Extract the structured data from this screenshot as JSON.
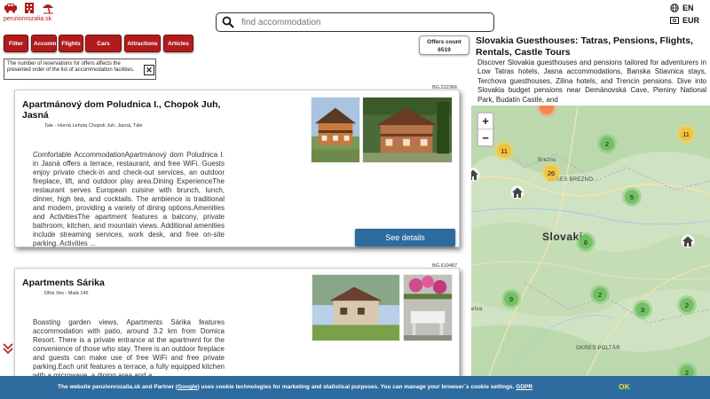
{
  "site": {
    "logo_text": "penzionrozalia.sk"
  },
  "search": {
    "placeholder": "find accommodation"
  },
  "lang": {
    "language": "EN",
    "currency": "EUR"
  },
  "nav": [
    {
      "label": "Filter"
    },
    {
      "label": "Accommodation"
    },
    {
      "label": "Flights"
    },
    {
      "label": "Cars"
    },
    {
      "label": "Attractions"
    },
    {
      "label": "Articles"
    }
  ],
  "offers": {
    "label": "Offers count",
    "count": "6519"
  },
  "notice": {
    "text": "The number of reservations for offers affects the presented order of the list of accommodation facilities."
  },
  "listings": [
    {
      "code": "BG.222366",
      "title": "Apartmánový dom Poludnica I., Chopok Juh, Jasná",
      "address": "Tale - Horná Lehota Chopok Juh, Jasná, Tále",
      "description": "Comfortable AccommodationApartmánový dom Poludnica I. in Jasná offers a terrace, restaurant, and free WiFi. Guests enjoy private check-in and check-out services, an outdoor fireplace, lift, and outdoor play area.Dining ExperienceThe restaurant serves European cuisine with brunch, lunch, dinner, high tea, and cocktails. The ambience is traditional and modern, providing a variety of dining options.Amenities and ActivitiesThe apartment features a balcony, private bathroom, kitchen, and mountain views. Additional amenities include streaming services, work desk, and free on-site parking. Activities ...",
      "button": "See details"
    },
    {
      "code": "BG.610487",
      "title": "Apartments Sárika",
      "address": "Dlhá Ves - Malá 146",
      "description": "Boasting garden views, Apartments Sárika features accommodation with patio, around 3.2 km from Domica Resort. There is a private entrance at the apartment for the convenience of those who stay. There is an outdoor fireplace and guests can make use of free WiFi and free private parking.Each unit features a terrace, a fully equipped kitchen with a microwave, a dining area and a"
    }
  ],
  "right_panel": {
    "title": "Slovakia Guesthouses: Tatras, Pensions, Flights, Rentals, Castle Tours",
    "text": "Discover Slovakia guesthouses and pensions tailored for adventurers in Low Tatras hotels, Jasna accommodations, Banska Stiavnica stays, Terchova guesthouses, Zilina hotels, and Trencin pensions. Dive into Slovakia budget pensions near Demänovská Cave, Pieniny National Park, Budatin Castle, and"
  },
  "map": {
    "zoom_in": "+",
    "zoom_out": "−",
    "labels": {
      "country": "Slovakia",
      "brezno_city": "Brezno",
      "okres_brezno": "OKRES BREZNO",
      "okres_poltar": "OKRES POLTÁR",
      "evta": "etva"
    },
    "clusters": [
      "11",
      "2",
      "11",
      "26",
      "5",
      "6",
      "2",
      "9",
      "3",
      "2",
      "2"
    ]
  },
  "cookie": {
    "text_before": "The website penzionrozalia.sk and Partner (",
    "google": "Google",
    "text_after": ") uses cookie technologies for marketing and statistical purposes. You can manage your browser´s cookie settings.",
    "gdpr": "GDPR",
    "ok": "OK"
  },
  "colors": {
    "brand_red": "#b01c1c",
    "button_blue": "#2d6b9e",
    "cookie_bar": "#2e6b9f",
    "ok_yellow": "#f5d84a"
  }
}
